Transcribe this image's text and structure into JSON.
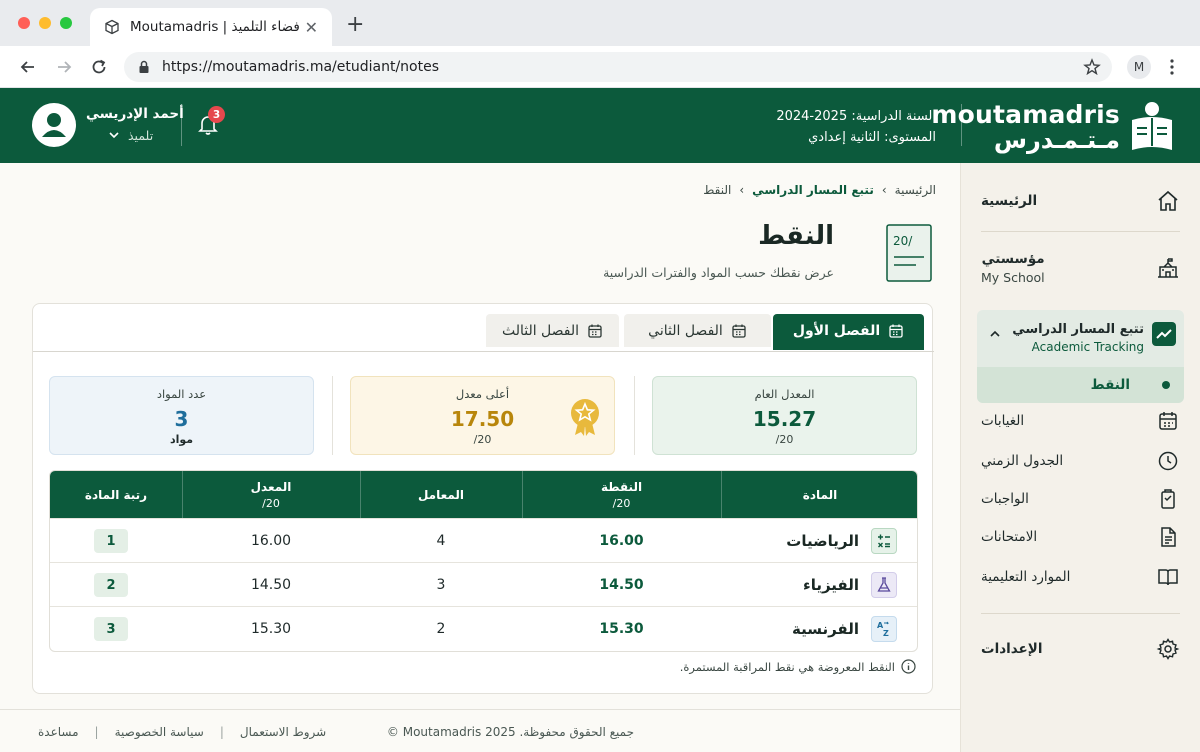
{
  "browser": {
    "tab_title": "Moutamadris | فضاء التلميذ",
    "url": "https://moutamadris.ma/etudiant/notes",
    "profile_initial": "M"
  },
  "header": {
    "brand_latin": "moutamadris",
    "brand_arabic": "مـتـمـدرس",
    "school_year": "السنة الدراسية: 2025-2024",
    "level": "المستوى: الثانية إعدادي",
    "notification_count": "3",
    "user_name": "أحمد الإدريسي",
    "user_role": "تلميذ"
  },
  "sidebar": {
    "home": "الرئيسية",
    "school_ar": "مؤسستي",
    "school_en": "My School",
    "tracking_ar": "تتبع المسار الدراسي",
    "tracking_en": "Academic Tracking",
    "sub_items": [
      "النقط",
      "الغيابات",
      "الجدول الزمني",
      "الواجبات",
      "الامتحانات",
      "الموارد التعليمية"
    ],
    "settings": "الإعدادات"
  },
  "breadcrumb": {
    "home": "الرئيسية",
    "section": "تتبع المسار الدراسي",
    "current": "النقط"
  },
  "page": {
    "title": "النقط",
    "subtitle": "عرض نقطك حسب المواد والفترات الدراسية",
    "icon_text": "20/"
  },
  "tabs": [
    "الفصل الأول",
    "الفصل الثاني",
    "الفصل الثالث"
  ],
  "stats": {
    "general": {
      "label": "المعدل العام",
      "value": "15.27",
      "sub": "/20"
    },
    "best": {
      "label": "أعلى معدل",
      "value": "17.50",
      "sub": "/20"
    },
    "count": {
      "label": "عدد المواد",
      "value": "3",
      "sub": "مواد"
    }
  },
  "table": {
    "headers": {
      "subject": "المادة",
      "grade": "النقطة",
      "grade_sub": "/20",
      "coef": "المعامل",
      "avg": "المعدل",
      "avg_sub": "/20",
      "rank": "رتبة المادة"
    },
    "rows": [
      {
        "subject": "الرياضيات",
        "grade": "16.00",
        "coef": "4",
        "avg": "16.00",
        "rank": "1",
        "icon": "calculator-icon"
      },
      {
        "subject": "الفيزياء",
        "grade": "14.50",
        "coef": "3",
        "avg": "14.50",
        "rank": "2",
        "icon": "flask-icon"
      },
      {
        "subject": "الفرنسية",
        "grade": "15.30",
        "coef": "2",
        "avg": "15.30",
        "rank": "3",
        "icon": "language-az-icon"
      }
    ]
  },
  "note": "النقط المعروضة هي نقط المراقبة المستمرة.",
  "footer": {
    "copyright": "جميع الحقوق محفوظة. Moutamadris 2025 ©",
    "links": [
      "مساعدة",
      "سياسة الخصوصية",
      "شروط الاستعمال"
    ]
  },
  "colors": {
    "primary": "#0c5a3c",
    "gold": "#b8860b",
    "blue": "#1f6e9c",
    "badge_red": "#e5484d"
  }
}
